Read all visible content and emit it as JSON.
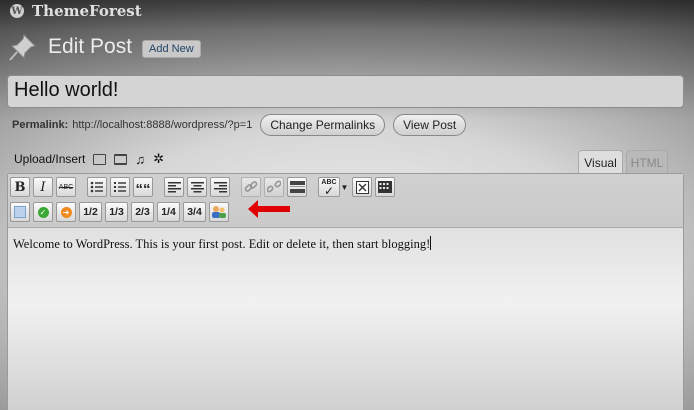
{
  "site": {
    "name": "ThemeForest"
  },
  "header": {
    "title": "Edit Post",
    "add_new": "Add New"
  },
  "post": {
    "title": "Hello world!",
    "permalink_label": "Permalink:",
    "permalink_url": "http://localhost:8888/wordpress/?p=1",
    "change_permalinks": "Change Permalinks",
    "view_post": "View Post",
    "content": "Welcome to WordPress. This is your first post. Edit or delete it, then start blogging!"
  },
  "media": {
    "label": "Upload/Insert"
  },
  "tabs": {
    "visual": "Visual",
    "html": "HTML"
  },
  "toolbar": {
    "bold": "B",
    "italic": "I",
    "strike": "ABC",
    "spell": "ABC",
    "blockquote": "““",
    "columns": [
      "1/2",
      "1/3",
      "2/3",
      "1/4",
      "3/4"
    ]
  },
  "colors": {
    "arrow": "#e00000",
    "green": "#3aa835",
    "orange": "#f08a1c",
    "blue_box": "#bcd3ee"
  }
}
